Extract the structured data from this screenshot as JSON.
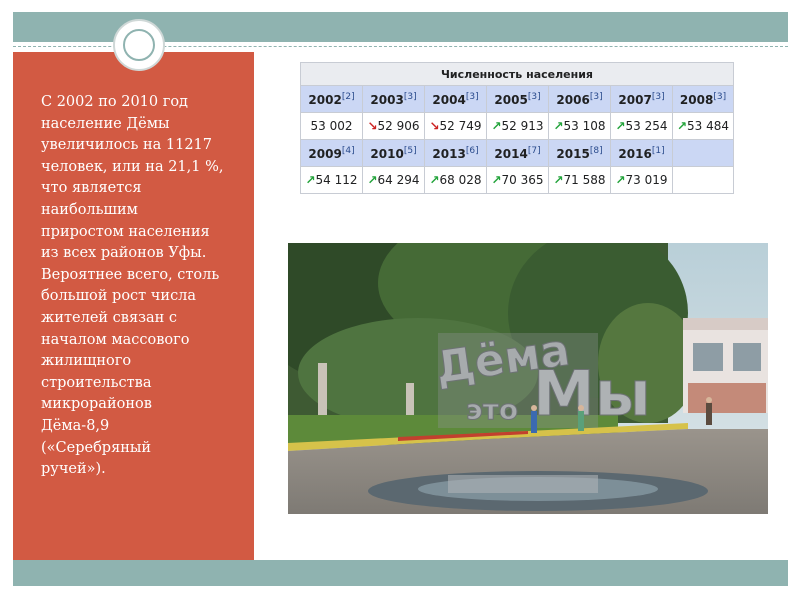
{
  "slide": {
    "text": "С 2002 по 2010 год\nнаселение Дёмы\nувеличилось на 11217\nчеловек, или на 21,1 %,\nчто является\nнаибольшим\nприростом населения\nиз всех районов Уфы.\nВероятнее всего, столь\nбольшой рост числа\nжителей связан с\nначалом массового\nжилищного\nстроительства\nмикрорайонов\nДёма-8,9\n(«Серебряный\nручей»)."
  },
  "table": {
    "caption": "Численность населения",
    "rows": [
      {
        "years": [
          {
            "year": "2002",
            "ref": "[2]"
          },
          {
            "year": "2003",
            "ref": "[3]"
          },
          {
            "year": "2004",
            "ref": "[3]"
          },
          {
            "year": "2005",
            "ref": "[3]"
          },
          {
            "year": "2006",
            "ref": "[3]"
          },
          {
            "year": "2007",
            "ref": "[3]"
          },
          {
            "year": "2008",
            "ref": "[3]"
          }
        ],
        "values": [
          {
            "value": "53 002",
            "trend": "none"
          },
          {
            "value": "52 906",
            "trend": "down"
          },
          {
            "value": "52 749",
            "trend": "down"
          },
          {
            "value": "52 913",
            "trend": "up"
          },
          {
            "value": "53 108",
            "trend": "up"
          },
          {
            "value": "53 254",
            "trend": "up"
          },
          {
            "value": "53 484",
            "trend": "up"
          }
        ]
      },
      {
        "years": [
          {
            "year": "2009",
            "ref": "[4]"
          },
          {
            "year": "2010",
            "ref": "[5]"
          },
          {
            "year": "2013",
            "ref": "[6]"
          },
          {
            "year": "2014",
            "ref": "[7]"
          },
          {
            "year": "2015",
            "ref": "[8]"
          },
          {
            "year": "2016",
            "ref": "[1]"
          }
        ],
        "values": [
          {
            "value": "54 112",
            "trend": "up"
          },
          {
            "value": "64 294",
            "trend": "up"
          },
          {
            "value": "68 028",
            "trend": "up"
          },
          {
            "value": "70 365",
            "trend": "up"
          },
          {
            "value": "71 588",
            "trend": "up"
          },
          {
            "value": "73 019",
            "trend": "up"
          }
        ]
      }
    ]
  },
  "photo": {
    "sign_top": "Дёма",
    "sign_mid": "это",
    "sign_right": "Мы"
  },
  "colors": {
    "panel": "#d25a43",
    "bar": "#8fb3b0",
    "up_arrow": "#22a33a",
    "down_arrow": "#cc2222"
  }
}
